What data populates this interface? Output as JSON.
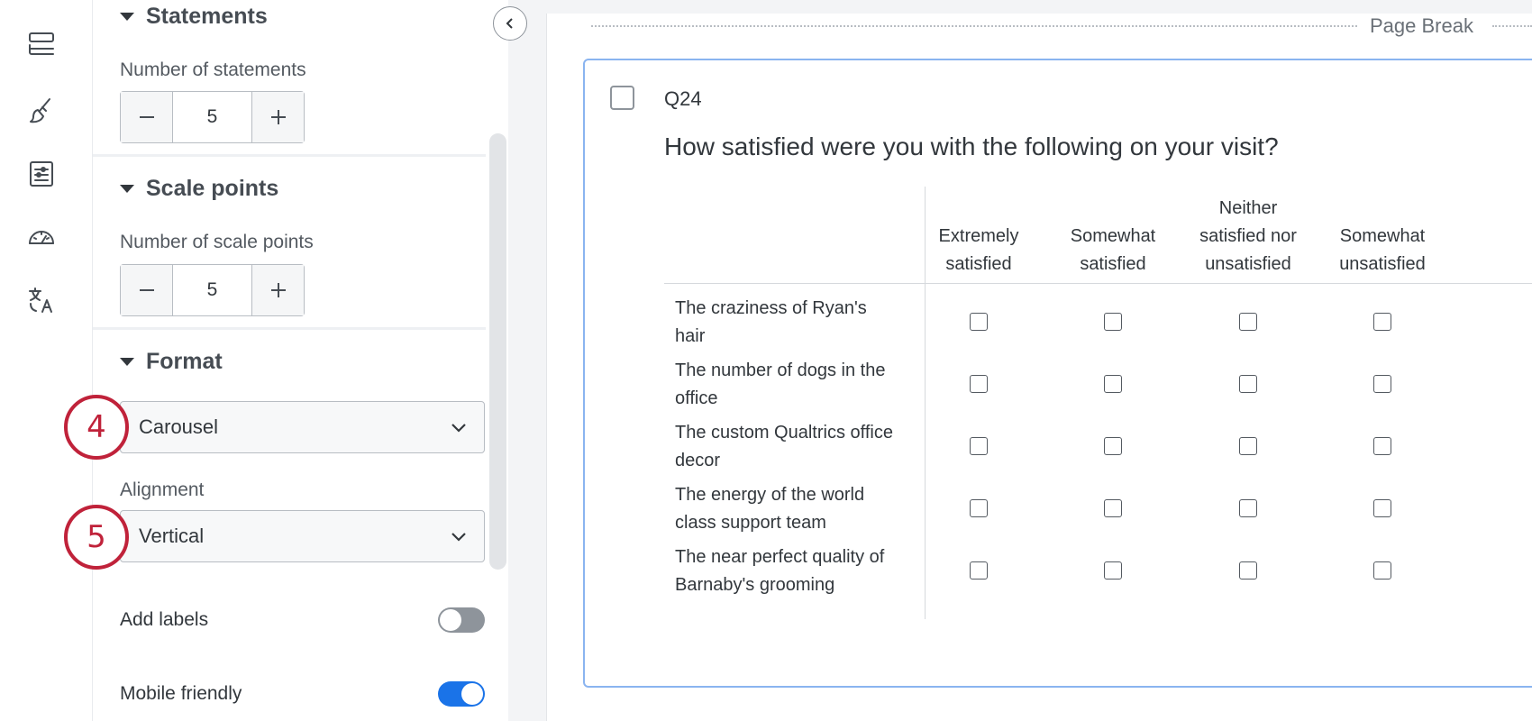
{
  "sidebar": {
    "sections": {
      "statements": {
        "title": "Statements",
        "field_label": "Number of statements",
        "value": "5"
      },
      "scale_points": {
        "title": "Scale points",
        "field_label": "Number of scale points",
        "value": "5"
      },
      "format": {
        "title": "Format",
        "format_value": "Carousel",
        "alignment_label": "Alignment",
        "alignment_value": "Vertical",
        "add_labels_label": "Add labels",
        "add_labels_on": false,
        "mobile_friendly_label": "Mobile friendly",
        "mobile_friendly_on": true
      }
    },
    "callouts": [
      "4",
      "5"
    ]
  },
  "canvas": {
    "page_break_label": "Page Break",
    "question": {
      "number": "Q24",
      "text": "How satisfied were you with the following on your visit?",
      "columns": [
        [
          "Extremely",
          "satisfied"
        ],
        [
          "Somewhat",
          "satisfied"
        ],
        [
          "Neither",
          "satisfied nor",
          "unsatisfied"
        ],
        [
          "Somewhat",
          "unsatisfied"
        ]
      ],
      "rows": [
        [
          "The craziness of Ryan's",
          "hair"
        ],
        [
          "The number of dogs in the",
          "office"
        ],
        [
          "The custom Qualtrics office",
          "decor"
        ],
        [
          "The energy of the world",
          "class support team"
        ],
        [
          "The near perfect quality of",
          "Barnaby's grooming"
        ]
      ]
    }
  },
  "colors": {
    "accent": "#1a73e8",
    "callout": "#c0223a",
    "card_border": "#8ab4f0"
  }
}
